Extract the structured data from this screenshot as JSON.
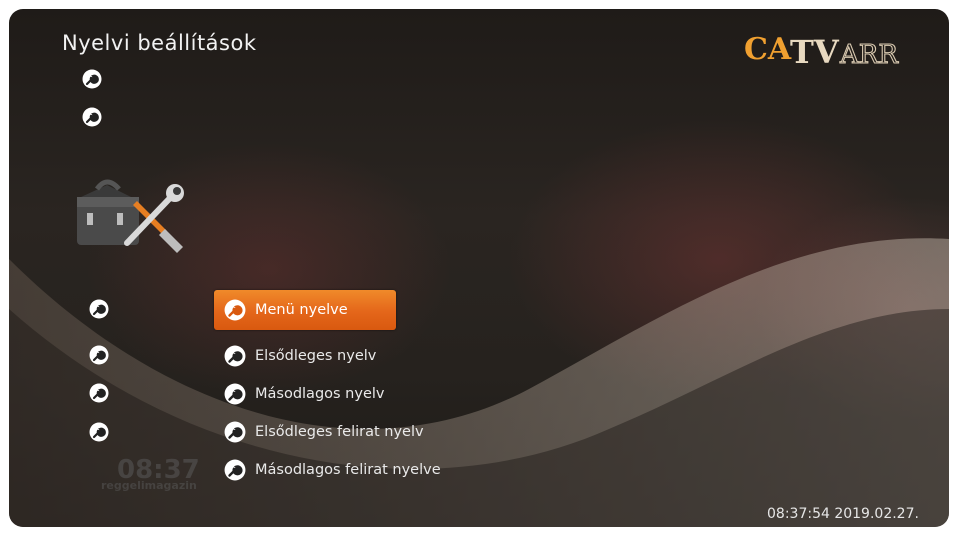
{
  "header": {
    "title": "Nyelvi beállítások"
  },
  "logo": {
    "text_left": "CA",
    "text_right": "TV",
    "text_tail": "ARR",
    "accent": "#f0a030"
  },
  "menu": {
    "items": [
      {
        "label": "Menü nyelve",
        "selected": true
      },
      {
        "label": "Elsődleges nyelv",
        "selected": false
      },
      {
        "label": "Másodlagos nyelv",
        "selected": false
      },
      {
        "label": "Elsődleges felirat nyelv",
        "selected": false
      },
      {
        "label": "Másodlagos felirat nyelve",
        "selected": false
      }
    ]
  },
  "status": {
    "datetime": "08:37:54 2019.02.27."
  },
  "background_watermark": {
    "time": "08:37",
    "channel": "reggelimagazin"
  },
  "colors": {
    "highlight": "#e86f1f",
    "text": "#e9e9e9",
    "icon": "#ffffff"
  },
  "icons": [
    "wrench-icon",
    "toolbox-icon"
  ]
}
